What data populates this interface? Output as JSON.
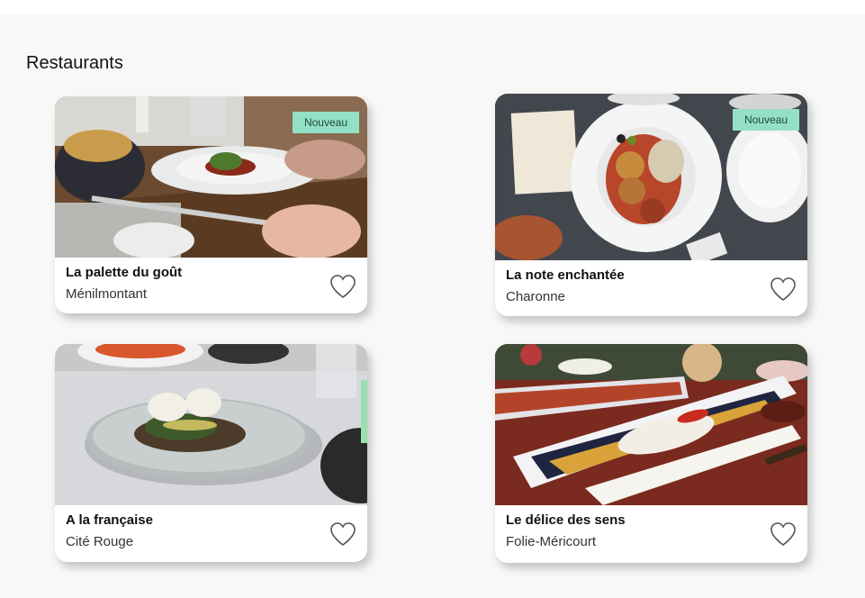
{
  "section": {
    "title": "Restaurants"
  },
  "badge_color": "#93e0c6",
  "restaurants": [
    {
      "name": "La palette du goût",
      "district": "Ménilmontant",
      "badge": "Nouveau",
      "favorite_icon": "heart-outline-icon"
    },
    {
      "name": "La note enchantée",
      "district": "Charonne",
      "badge": "Nouveau",
      "favorite_icon": "heart-outline-icon"
    },
    {
      "name": "A la française",
      "district": "Cité Rouge",
      "favorite_icon": "heart-outline-icon"
    },
    {
      "name": "Le délice des sens",
      "district": "Folie-Méricourt",
      "favorite_icon": "heart-outline-icon"
    }
  ]
}
